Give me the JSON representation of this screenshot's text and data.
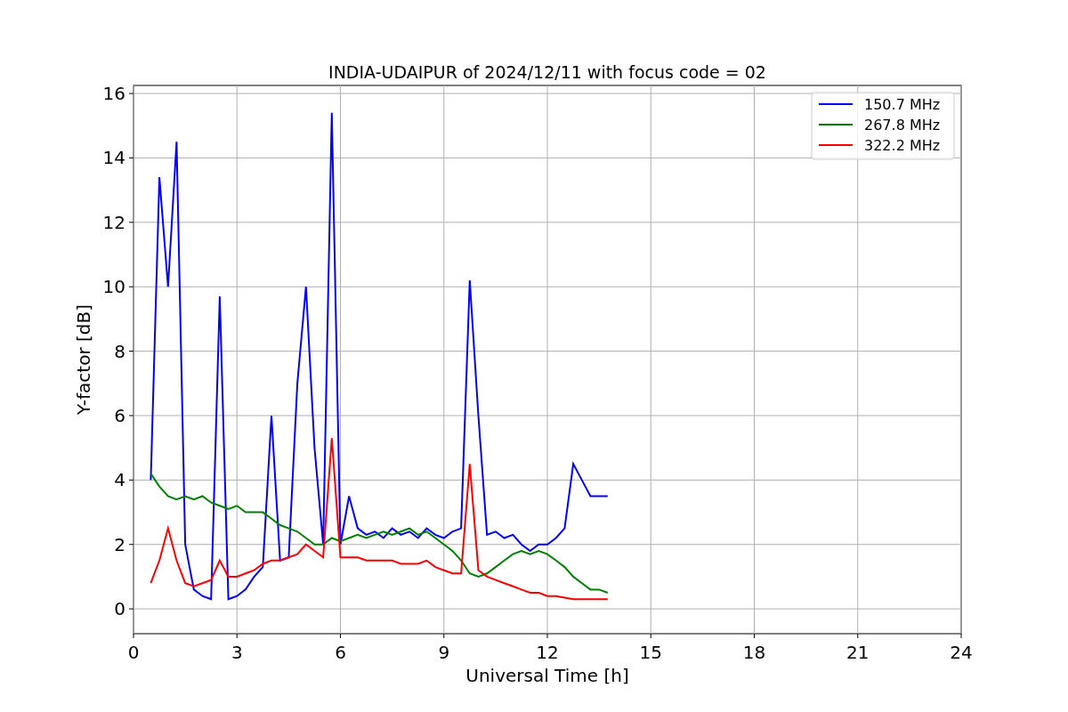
{
  "chart_data": {
    "type": "line",
    "title": "INDIA-UDAIPUR of 2024/12/11 with focus code = 02",
    "xlabel": "Universal Time [h]",
    "ylabel": "Y-factor [dB]",
    "xlim": [
      0,
      24
    ],
    "ylim": [
      -0.77,
      16.25
    ],
    "xticks": [
      0,
      3,
      6,
      9,
      12,
      15,
      18,
      21,
      24
    ],
    "yticks": [
      0,
      2,
      4,
      6,
      8,
      10,
      12,
      14,
      16
    ],
    "grid": true,
    "legend": true,
    "x": [
      0.5,
      0.75,
      1.0,
      1.25,
      1.5,
      1.75,
      2.0,
      2.25,
      2.5,
      2.75,
      3.0,
      3.25,
      3.5,
      3.75,
      4.0,
      4.25,
      4.5,
      4.75,
      5.0,
      5.25,
      5.5,
      5.75,
      6.0,
      6.25,
      6.5,
      6.75,
      7.0,
      7.25,
      7.5,
      7.75,
      8.0,
      8.25,
      8.5,
      8.75,
      9.0,
      9.25,
      9.5,
      9.75,
      10.0,
      10.25,
      10.5,
      10.75,
      11.0,
      11.25,
      11.5,
      11.75,
      12.0,
      12.25,
      12.5,
      12.75,
      13.0,
      13.25,
      13.5,
      13.75
    ],
    "series": [
      {
        "name": "150.7 MHz",
        "color": "#0000ff",
        "values": [
          4,
          13.4,
          10,
          14.5,
          2,
          0.6,
          0.4,
          0.3,
          9.7,
          0.3,
          0.4,
          0.6,
          1.0,
          1.3,
          6,
          1.5,
          1.6,
          7,
          10,
          5,
          2,
          15.4,
          2.0,
          3.5,
          2.5,
          2.3,
          2.4,
          2.2,
          2.5,
          2.3,
          2.4,
          2.2,
          2.5,
          2.3,
          2.2,
          2.4,
          2.5,
          10.2,
          6,
          2.3,
          2.4,
          2.2,
          2.3,
          2.0,
          1.8,
          2.0,
          2.0,
          2.2,
          2.5,
          4.5,
          4.0,
          3.5,
          3.5,
          3.5
        ]
      },
      {
        "name": "267.8 MHz",
        "color": "#008000",
        "values": [
          4.2,
          3.8,
          3.5,
          3.4,
          3.5,
          3.4,
          3.5,
          3.3,
          3.2,
          3.1,
          3.2,
          3.0,
          3.0,
          3.0,
          2.8,
          2.6,
          2.5,
          2.4,
          2.2,
          2.0,
          2.0,
          2.2,
          2.1,
          2.2,
          2.3,
          2.2,
          2.3,
          2.4,
          2.3,
          2.4,
          2.5,
          2.3,
          2.4,
          2.2,
          2.0,
          1.8,
          1.5,
          1.1,
          1.0,
          1.1,
          1.3,
          1.5,
          1.7,
          1.8,
          1.7,
          1.8,
          1.7,
          1.5,
          1.3,
          1.0,
          0.8,
          0.6,
          0.6,
          0.5
        ]
      },
      {
        "name": "322.2 MHz",
        "color": "#ff0000",
        "values": [
          0.8,
          1.5,
          2.5,
          1.5,
          0.8,
          0.7,
          0.8,
          0.9,
          1.5,
          1.0,
          1.0,
          1.1,
          1.2,
          1.4,
          1.5,
          1.5,
          1.6,
          1.7,
          2.0,
          1.8,
          1.6,
          5.3,
          1.6,
          1.6,
          1.6,
          1.5,
          1.5,
          1.5,
          1.5,
          1.4,
          1.4,
          1.4,
          1.5,
          1.3,
          1.2,
          1.1,
          1.1,
          4.5,
          1.2,
          1.0,
          0.9,
          0.8,
          0.7,
          0.6,
          0.5,
          0.5,
          0.4,
          0.4,
          0.35,
          0.3,
          0.3,
          0.3,
          0.3,
          0.3
        ]
      }
    ]
  }
}
